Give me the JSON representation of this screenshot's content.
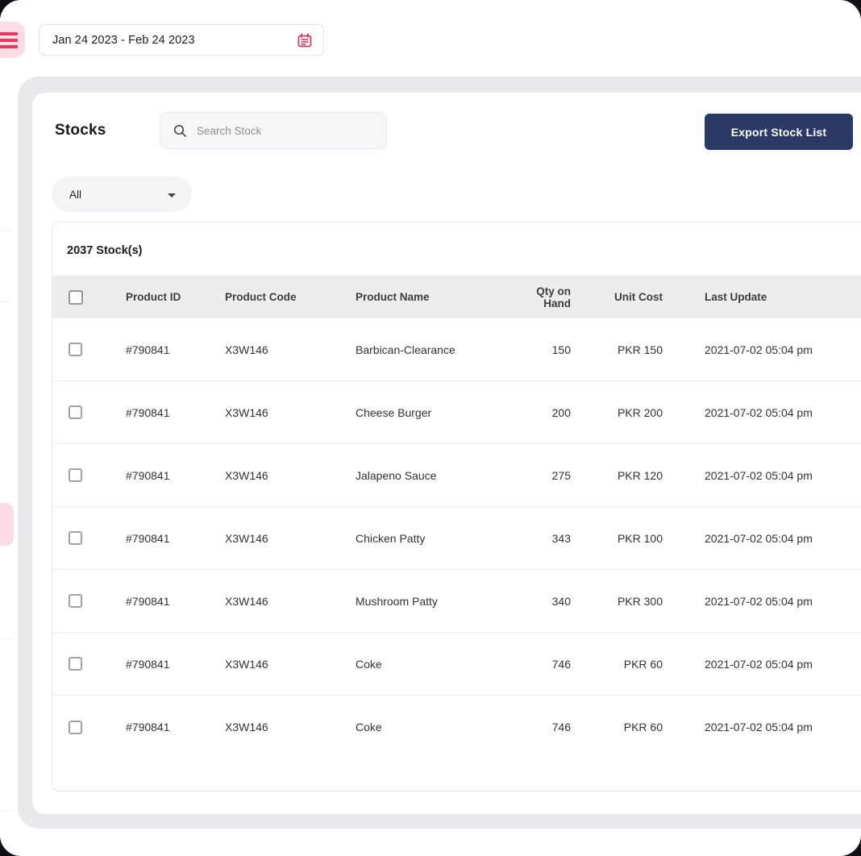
{
  "topbar": {
    "date_range": "Jan 24 2023 - Feb 24 2023"
  },
  "stocks": {
    "title": "Stocks",
    "search_placeholder": "Search Stock",
    "export_label": "Export Stock List",
    "filter_value": "All",
    "table": {
      "count_label": "2037 Stock(s)",
      "columns": [
        "Product ID",
        "Product Code",
        "Product Name",
        "Qty on Hand",
        "Unit Cost",
        "Last Update"
      ],
      "rows": [
        {
          "product_id": "#790841",
          "product_code": "X3W146",
          "product_name": "Barbican-Clearance",
          "qty_on_hand": "150",
          "unit_cost": "PKR 150",
          "last_update": "2021-07-02 05:04 pm"
        },
        {
          "product_id": "#790841",
          "product_code": "X3W146",
          "product_name": "Cheese Burger",
          "qty_on_hand": "200",
          "unit_cost": "PKR 200",
          "last_update": "2021-07-02 05:04 pm"
        },
        {
          "product_id": "#790841",
          "product_code": "X3W146",
          "product_name": "Jalapeno Sauce",
          "qty_on_hand": "275",
          "unit_cost": "PKR 120",
          "last_update": "2021-07-02 05:04 pm"
        },
        {
          "product_id": "#790841",
          "product_code": "X3W146",
          "product_name": "Chicken Patty",
          "qty_on_hand": "343",
          "unit_cost": "PKR 100",
          "last_update": "2021-07-02 05:04 pm"
        },
        {
          "product_id": "#790841",
          "product_code": "X3W146",
          "product_name": "Mushroom Patty",
          "qty_on_hand": "340",
          "unit_cost": "PKR 300",
          "last_update": "2021-07-02 05:04 pm"
        },
        {
          "product_id": "#790841",
          "product_code": "X3W146",
          "product_name": "Coke",
          "qty_on_hand": "746",
          "unit_cost": "PKR 60",
          "last_update": "2021-07-02 05:04 pm"
        },
        {
          "product_id": "#790841",
          "product_code": "X3W146",
          "product_name": "Coke",
          "qty_on_hand": "746",
          "unit_cost": "PKR 60",
          "last_update": "2021-07-02 05:04 pm"
        }
      ]
    },
    "colors": {
      "accent_pink": "#e23a60",
      "accent_pink_bg": "#fadce4",
      "export_navy": "#2b3a64",
      "content_bg": "#e9e9ed"
    }
  }
}
